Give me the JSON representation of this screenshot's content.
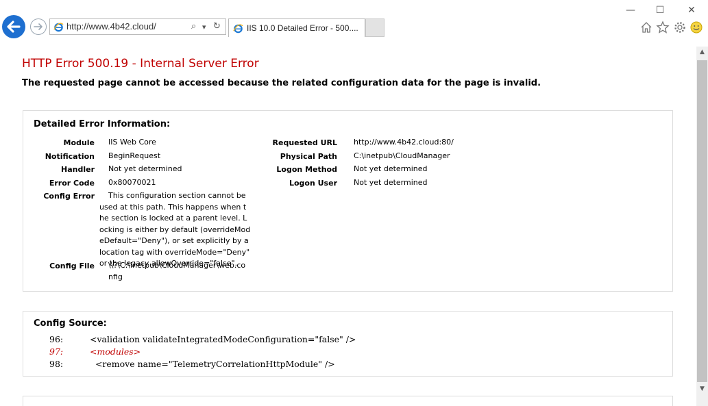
{
  "browser": {
    "url": "http://www.4b42.cloud/",
    "tab_title": "IIS 10.0 Detailed Error - 500....",
    "window_controls": {
      "minimize": "—",
      "maximize": "☐",
      "close": "✕"
    },
    "address_tools": {
      "search": "⌕",
      "dropdown": "▾",
      "refresh": "↻"
    },
    "toolbar_icons": [
      "home-icon",
      "favorites-star-icon",
      "settings-gear-icon",
      "feedback-smiley-icon"
    ],
    "colors": {
      "accent": "#1e6fd0",
      "error": "#c00000"
    }
  },
  "page": {
    "title": "HTTP Error 500.19 - Internal Server Error",
    "subtitle": "The requested page cannot be accessed because the related configuration data for the page is invalid."
  },
  "detailed": {
    "heading": "Detailed Error Information:",
    "left": [
      {
        "label": "Module",
        "value": "IIS Web Core"
      },
      {
        "label": "Notification",
        "value": "BeginRequest"
      },
      {
        "label": "Handler",
        "value": "Not yet determined"
      },
      {
        "label": "Error Code",
        "value": "0x80070021"
      },
      {
        "label": "Config Error",
        "lines": [
          "This configuration section cannot be",
          "used at this path. This happens when t",
          "he section is locked at a parent level. L",
          "ocking is either by default (overrideMod",
          "eDefault=\"Deny\"), or set explicitly by a",
          "location tag with overrideMode=\"Deny\"",
          "or the legacy allowOverride=\"false\"."
        ]
      },
      {
        "label": "Config File",
        "lines": [
          "\\\\?\\C:\\inetpub\\CloudManager\\web.co",
          "nfig"
        ]
      }
    ],
    "right": [
      {
        "label": "Requested URL",
        "value": "http://www.4b42.cloud:80/"
      },
      {
        "label": "Physical Path",
        "value": "C:\\inetpub\\CloudManager"
      },
      {
        "label": "Logon Method",
        "value": "Not yet determined"
      },
      {
        "label": "Logon User",
        "value": "Not yet determined"
      }
    ]
  },
  "config_source": {
    "heading": "Config Source:",
    "lines": [
      {
        "num": "96:",
        "code": "<validation validateIntegratedModeConfiguration=\"false\" />"
      },
      {
        "num": "97:",
        "code": "<modules>"
      },
      {
        "num": "98:",
        "code": "  <remove name=\"TelemetryCorrelationHttpModule\" />"
      }
    ]
  }
}
